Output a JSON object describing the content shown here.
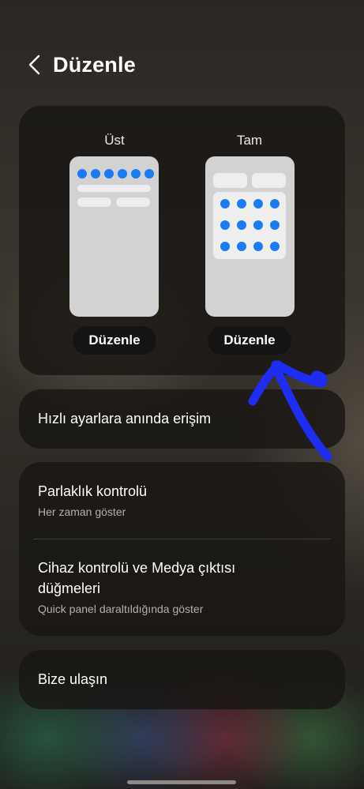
{
  "header": {
    "back_icon": "chevron-left-icon",
    "title": "Düzenle"
  },
  "layout_options": [
    {
      "label": "Üst",
      "button_label": "Düzenle"
    },
    {
      "label": "Tam",
      "button_label": "Düzenle"
    }
  ],
  "quick_access": {
    "title": "Hızlı ayarlara anında erişim"
  },
  "brightness": {
    "title": "Parlaklık kontrolü",
    "subtitle": "Her zaman göster"
  },
  "device_media": {
    "title_line1": "Cihaz kontrolü ve Medya çıktısı",
    "title_line2": "düğmeleri",
    "subtitle": "Quick panel daraltıldığında göster"
  },
  "contact": {
    "title": "Bize ulaşın"
  },
  "colors": {
    "accent_blue": "#1a7cf2",
    "annotation_blue": "#1f2cf2",
    "card_bg": "#181614",
    "button_bg": "#141414"
  }
}
